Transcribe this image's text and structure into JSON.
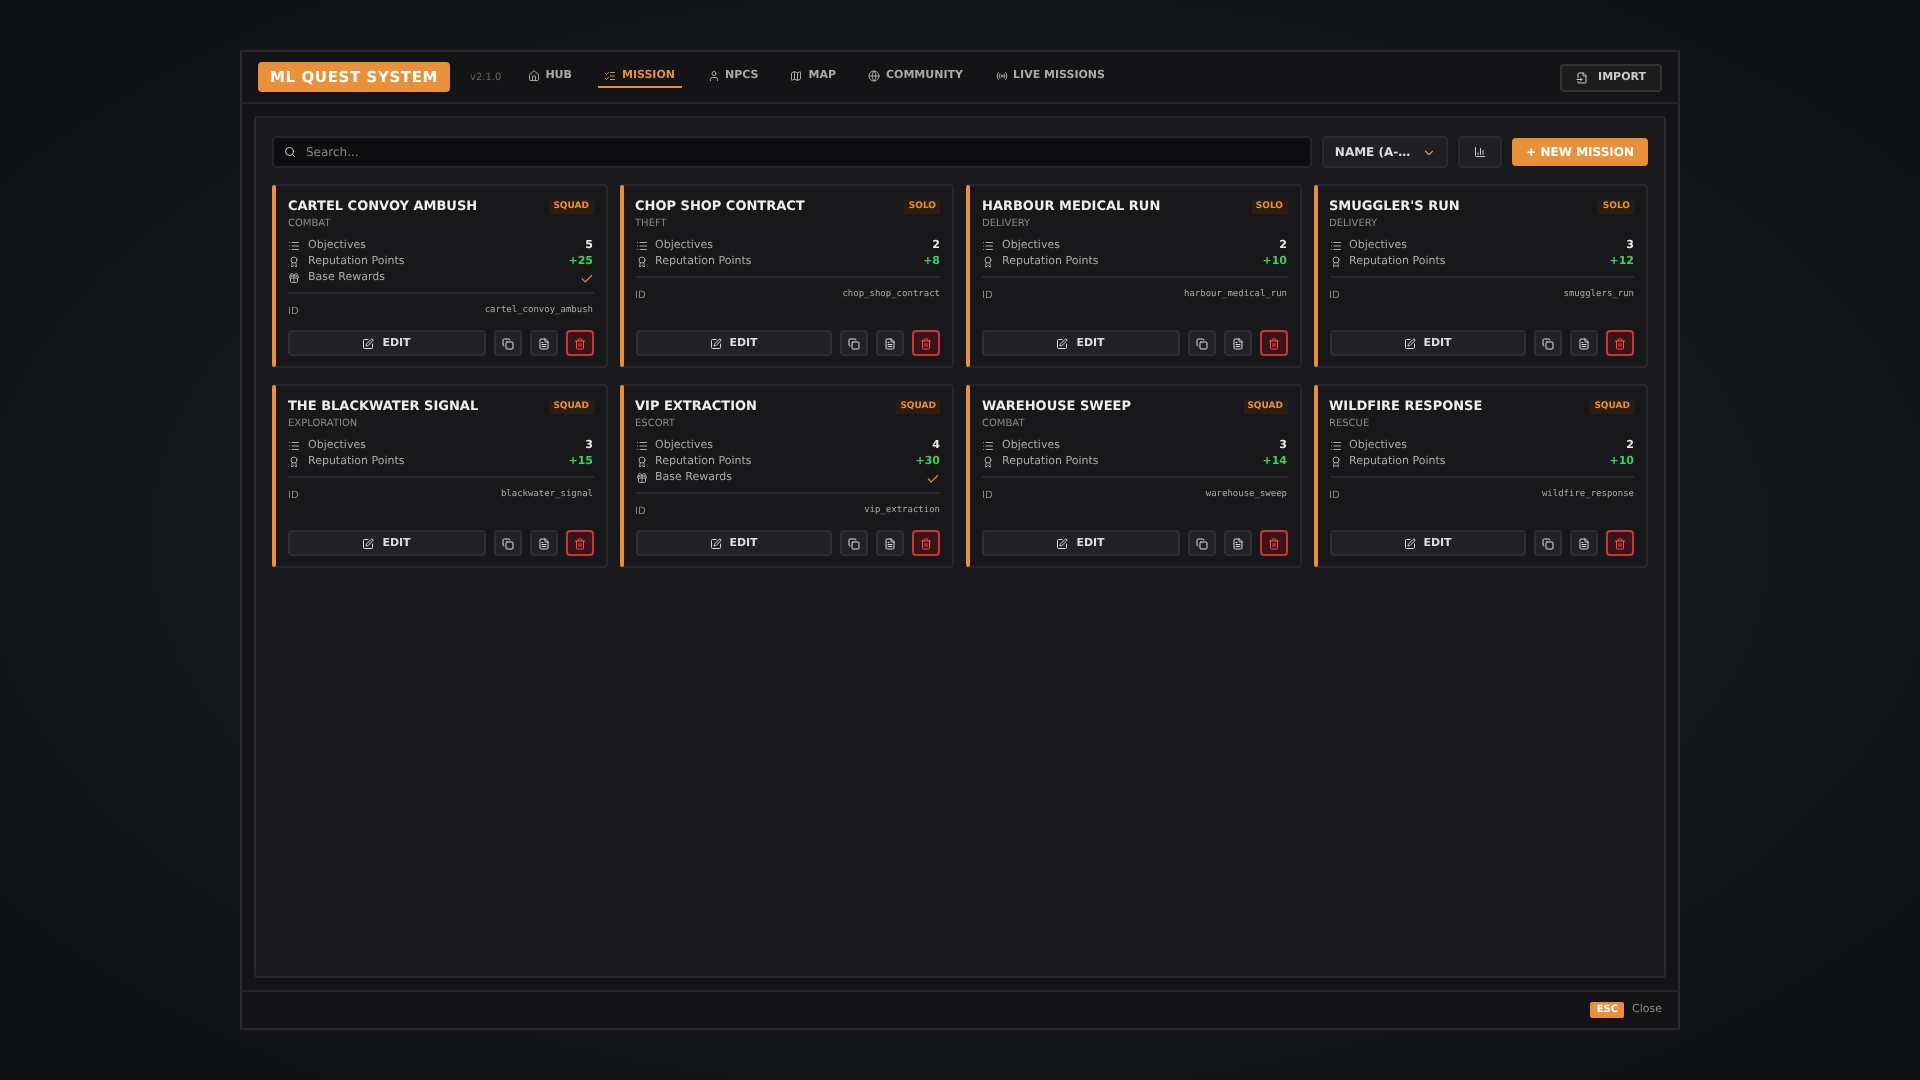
{
  "app": {
    "title": "ML QUEST SYSTEM",
    "version": "v2.1.0"
  },
  "nav": [
    {
      "label": "HUB",
      "selected": false
    },
    {
      "label": "MISSION",
      "selected": true
    },
    {
      "label": "NPCS",
      "selected": false
    },
    {
      "label": "MAP",
      "selected": false
    },
    {
      "label": "COMMUNITY",
      "selected": false
    },
    {
      "label": "LIVE MISSIONS",
      "selected": false
    }
  ],
  "import_button": "IMPORT",
  "toolbar": {
    "search_placeholder": "Search...",
    "sort": "NAME (A-…",
    "new_button": "+ NEW MISSION"
  },
  "missions": [
    {
      "title": "CARTEL CONVOY AMBUSH",
      "mode": "SQUAD",
      "category": "COMBAT",
      "stats": [
        {
          "kind": "objectives",
          "label": "Objectives",
          "value": "5"
        },
        {
          "kind": "reputation",
          "label": "Reputation Points",
          "value": "+25"
        },
        {
          "kind": "rewards",
          "label": "Base Rewards",
          "checked": true
        }
      ],
      "id_label": "ID",
      "id": "cartel_convoy_ambush",
      "edit": "EDIT"
    },
    {
      "title": "CHOP SHOP CONTRACT",
      "mode": "SOLO",
      "category": "THEFT",
      "stats": [
        {
          "kind": "objectives",
          "label": "Objectives",
          "value": "2"
        },
        {
          "kind": "reputation",
          "label": "Reputation Points",
          "value": "+8"
        }
      ],
      "id_label": "ID",
      "id": "chop_shop_contract",
      "edit": "EDIT"
    },
    {
      "title": "HARBOUR MEDICAL RUN",
      "mode": "SOLO",
      "category": "DELIVERY",
      "stats": [
        {
          "kind": "objectives",
          "label": "Objectives",
          "value": "2"
        },
        {
          "kind": "reputation",
          "label": "Reputation Points",
          "value": "+10"
        }
      ],
      "id_label": "ID",
      "id": "harbour_medical_run",
      "edit": "EDIT"
    },
    {
      "title": "SMUGGLER'S RUN",
      "mode": "SOLO",
      "category": "DELIVERY",
      "stats": [
        {
          "kind": "objectives",
          "label": "Objectives",
          "value": "3"
        },
        {
          "kind": "reputation",
          "label": "Reputation Points",
          "value": "+12"
        }
      ],
      "id_label": "ID",
      "id": "smugglers_run",
      "edit": "EDIT"
    },
    {
      "title": "THE BLACKWATER SIGNAL",
      "mode": "SQUAD",
      "category": "EXPLORATION",
      "stats": [
        {
          "kind": "objectives",
          "label": "Objectives",
          "value": "3"
        },
        {
          "kind": "reputation",
          "label": "Reputation Points",
          "value": "+15"
        }
      ],
      "id_label": "ID",
      "id": "blackwater_signal",
      "edit": "EDIT"
    },
    {
      "title": "VIP EXTRACTION",
      "mode": "SQUAD",
      "category": "ESCORT",
      "stats": [
        {
          "kind": "objectives",
          "label": "Objectives",
          "value": "4"
        },
        {
          "kind": "reputation",
          "label": "Reputation Points",
          "value": "+30"
        },
        {
          "kind": "rewards",
          "label": "Base Rewards",
          "checked": true
        }
      ],
      "id_label": "ID",
      "id": "vip_extraction",
      "edit": "EDIT"
    },
    {
      "title": "WAREHOUSE SWEEP",
      "mode": "SQUAD",
      "category": "COMBAT",
      "stats": [
        {
          "kind": "objectives",
          "label": "Objectives",
          "value": "3"
        },
        {
          "kind": "reputation",
          "label": "Reputation Points",
          "value": "+14"
        }
      ],
      "id_label": "ID",
      "id": "warehouse_sweep",
      "edit": "EDIT"
    },
    {
      "title": "WILDFIRE RESPONSE",
      "mode": "SQUAD",
      "category": "RESCUE",
      "stats": [
        {
          "kind": "objectives",
          "label": "Objectives",
          "value": "2"
        },
        {
          "kind": "reputation",
          "label": "Reputation Points",
          "value": "+10"
        }
      ],
      "id_label": "ID",
      "id": "wildfire_response",
      "edit": "EDIT"
    }
  ],
  "footer": {
    "key": "ESC",
    "label": "Close"
  }
}
